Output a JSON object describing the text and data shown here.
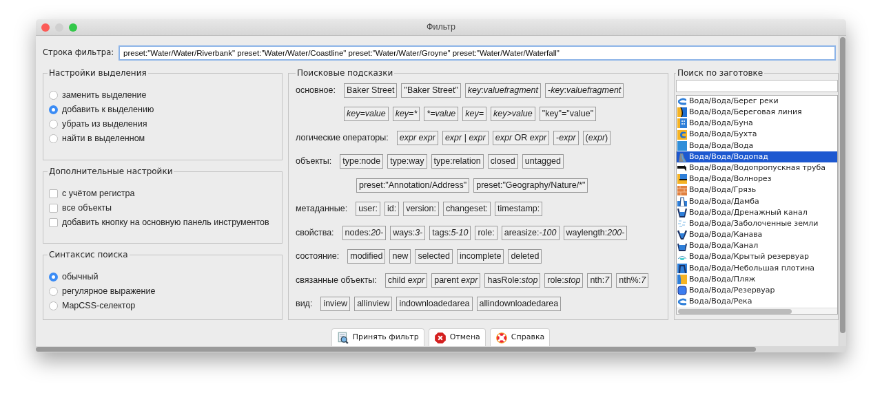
{
  "window": {
    "title": "Фильтр"
  },
  "filter": {
    "label": "Строка фильтра:",
    "value": "preset:\"Water/Water/Riverbank\" preset:\"Water/Water/Coastline\" preset:\"Water/Water/Groyne\" preset:\"Water/Water/Waterfall\""
  },
  "selection_settings": {
    "title": "Настройки выделения",
    "options": [
      {
        "label": "заменить выделение",
        "selected": false
      },
      {
        "label": "добавить к выделению",
        "selected": true
      },
      {
        "label": "убрать из выделения",
        "selected": false
      },
      {
        "label": "найти в выделенном",
        "selected": false
      }
    ]
  },
  "extra_settings": {
    "title": "Дополнительные настройки",
    "options": [
      {
        "label": "с учётом регистра",
        "checked": false
      },
      {
        "label": "все объекты",
        "checked": false
      },
      {
        "label": "добавить кнопку на основную панель инструментов",
        "checked": false
      }
    ]
  },
  "syntax": {
    "title": "Синтаксис поиска",
    "options": [
      {
        "label": "обычный",
        "selected": true
      },
      {
        "label": "регулярное выражение",
        "selected": false
      },
      {
        "label": "MapCSS-селектор",
        "selected": false
      }
    ]
  },
  "hints": {
    "title": "Поисковые подсказки",
    "rows": [
      {
        "label": "основное:",
        "chips": [
          {
            "text": "Baker Street"
          },
          {
            "text": "\"Baker Street\""
          },
          {
            "text": "*key*:*valuefragment*"
          },
          {
            "text": "-*key*:*valuefragment*"
          }
        ]
      },
      {
        "chips": [
          {
            "text": "key=value",
            "italic": true
          },
          {
            "text": "key=*",
            "italic": true
          },
          {
            "text": "*=value",
            "italic": true
          },
          {
            "text": "key=",
            "italic": true
          },
          {
            "text": "key>value",
            "italic": true
          },
          {
            "text": "\"key\"=\"value\""
          }
        ]
      },
      {
        "label": "логические операторы:",
        "chips": [
          {
            "text": "expr expr",
            "italic": true
          },
          {
            "text": "*expr* | *expr*"
          },
          {
            "text": "*expr* OR *expr*"
          },
          {
            "text": "-*expr*"
          },
          {
            "text": "(*expr*)"
          }
        ]
      },
      {
        "label": "объекты:",
        "chips": [
          {
            "text": "type:node"
          },
          {
            "text": "type:way"
          },
          {
            "text": "type:relation"
          },
          {
            "text": "closed"
          },
          {
            "text": "untagged"
          }
        ]
      },
      {
        "chips": [
          {
            "text": "preset:\"Annotation/Address\""
          },
          {
            "text": "preset:\"Geography/Nature/*\""
          }
        ]
      },
      {
        "label": "метаданные:",
        "chips": [
          {
            "text": "user:"
          },
          {
            "text": "id:"
          },
          {
            "text": "version:"
          },
          {
            "text": "changeset:"
          },
          {
            "text": "timestamp:"
          }
        ]
      },
      {
        "label": "свойства:",
        "chips": [
          {
            "text": "nodes:*20-*"
          },
          {
            "text": "ways:*3-*"
          },
          {
            "text": "tags:*5-10*"
          },
          {
            "text": "role:"
          },
          {
            "text": "areasize:*-100*"
          },
          {
            "text": "waylength:*200-*"
          }
        ]
      },
      {
        "label": "состояние:",
        "chips": [
          {
            "text": "modified"
          },
          {
            "text": "new"
          },
          {
            "text": "selected"
          },
          {
            "text": "incomplete"
          },
          {
            "text": "deleted"
          }
        ]
      },
      {
        "label": "связанные объекты:",
        "chips": [
          {
            "text": "child *expr*"
          },
          {
            "text": "parent *expr*"
          },
          {
            "text": "hasRole:*stop*"
          },
          {
            "text": "role:*stop*"
          },
          {
            "text": "nth:*7*"
          },
          {
            "text": "nth%:*7*"
          }
        ]
      },
      {
        "label": "вид:",
        "chips": [
          {
            "text": "inview"
          },
          {
            "text": "allinview"
          },
          {
            "text": "indownloadedarea"
          },
          {
            "text": "allindownloadedarea"
          }
        ]
      }
    ]
  },
  "presets": {
    "title": "Поиск по заготовке",
    "items": [
      {
        "label": "Вода/Вода/Берег реки",
        "selected": false
      },
      {
        "label": "Вода/Вода/Береговая линия",
        "selected": false
      },
      {
        "label": "Вода/Вода/Буна",
        "selected": false
      },
      {
        "label": "Вода/Вода/Бухта",
        "selected": false
      },
      {
        "label": "Вода/Вода/Вода",
        "selected": false
      },
      {
        "label": "Вода/Вода/Водопад",
        "selected": true
      },
      {
        "label": "Вода/Вода/Водопропускная труба",
        "selected": false
      },
      {
        "label": "Вода/Вода/Волнорез",
        "selected": false
      },
      {
        "label": "Вода/Вода/Грязь",
        "selected": false
      },
      {
        "label": "Вода/Вода/Дамба",
        "selected": false
      },
      {
        "label": "Вода/Вода/Дренажный канал",
        "selected": false
      },
      {
        "label": "Вода/Вода/Заболоченные земли",
        "selected": false
      },
      {
        "label": "Вода/Вода/Канава",
        "selected": false
      },
      {
        "label": "Вода/Вода/Канал",
        "selected": false
      },
      {
        "label": "Вода/Вода/Крытый резервуар",
        "selected": false
      },
      {
        "label": "Вода/Вода/Небольшая плотина",
        "selected": false
      },
      {
        "label": "Вода/Вода/Пляж",
        "selected": false
      },
      {
        "label": "Вода/Вода/Резервуар",
        "selected": false
      },
      {
        "label": "Вода/Вода/Река",
        "selected": false
      }
    ]
  },
  "buttons": [
    {
      "kind": "apply",
      "label": "Принять фильтр"
    },
    {
      "kind": "cancel",
      "label": "Отмена"
    },
    {
      "kind": "help",
      "label": "Справка"
    }
  ]
}
